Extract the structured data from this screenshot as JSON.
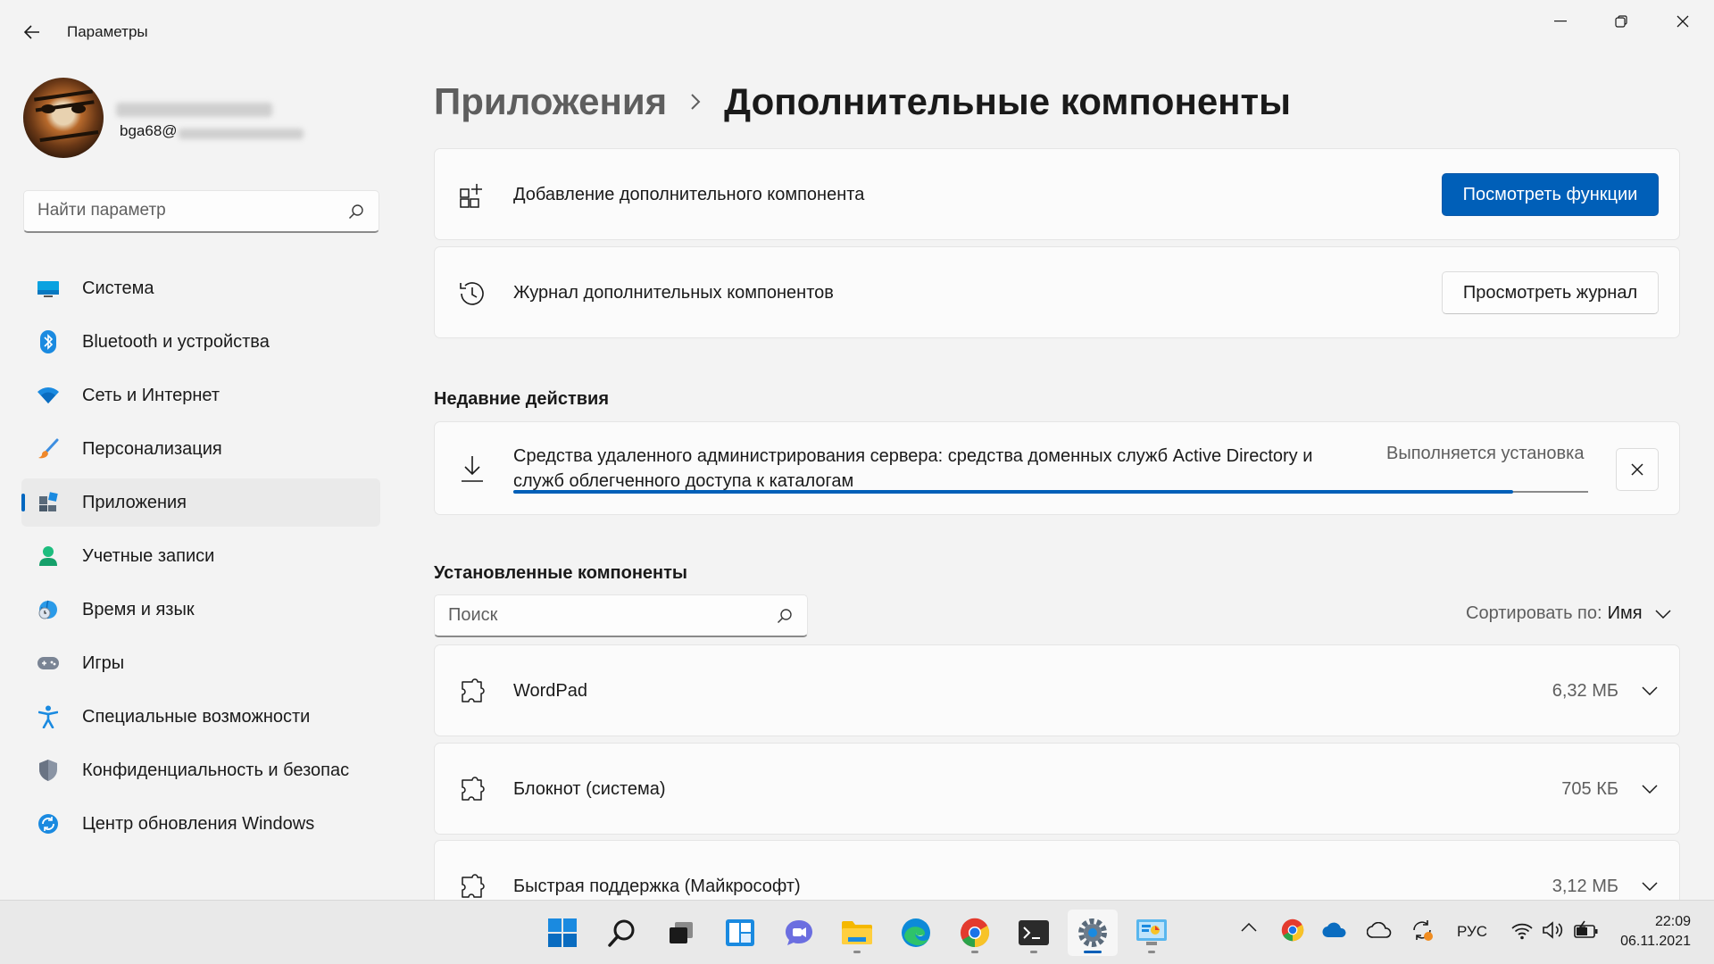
{
  "window": {
    "app_title": "Параметры"
  },
  "user": {
    "email_prefix": "bga68@"
  },
  "sidebar": {
    "search_placeholder": "Найти параметр",
    "items": [
      {
        "label": "Система",
        "icon": "monitor-icon",
        "active": false
      },
      {
        "label": "Bluetooth и устройства",
        "icon": "bluetooth-icon",
        "active": false
      },
      {
        "label": "Сеть и Интернет",
        "icon": "wifi-icon",
        "active": false
      },
      {
        "label": "Персонализация",
        "icon": "brush-icon",
        "active": false
      },
      {
        "label": "Приложения",
        "icon": "apps-icon",
        "active": true
      },
      {
        "label": "Учетные записи",
        "icon": "person-icon",
        "active": false
      },
      {
        "label": "Время и язык",
        "icon": "globe-clock-icon",
        "active": false
      },
      {
        "label": "Игры",
        "icon": "gamepad-icon",
        "active": false
      },
      {
        "label": "Специальные возможности",
        "icon": "accessibility-icon",
        "active": false
      },
      {
        "label": "Конфиденциальность и безопас",
        "icon": "shield-icon",
        "active": false
      },
      {
        "label": "Центр обновления Windows",
        "icon": "update-icon",
        "active": false
      }
    ]
  },
  "breadcrumb": {
    "parent": "Приложения",
    "current": "Дополнительные компоненты"
  },
  "cards": {
    "add": {
      "text": "Добавление дополнительного компонента",
      "button": "Посмотреть функции"
    },
    "history": {
      "text": "Журнал дополнительных компонентов",
      "button": "Просмотреть журнал"
    }
  },
  "recent": {
    "title": "Недавние действия",
    "item": {
      "line1": "Средства удаленного администрирования сервера: средства доменных служб Active Directory и",
      "line2": "служб облегченного доступа к каталогам",
      "status": "Выполняется установка",
      "progress": 0.93
    }
  },
  "installed": {
    "title": "Установленные компоненты",
    "search_placeholder": "Поиск",
    "sort_label": "Сортировать по:",
    "sort_value": "Имя",
    "items": [
      {
        "name": "WordPad",
        "size": "6,32 МБ"
      },
      {
        "name": "Блокнот (система)",
        "size": "705 КБ"
      },
      {
        "name": "Быстрая поддержка (Майкрософт)",
        "size": "3,12 МБ"
      }
    ]
  },
  "taskbar": {
    "language": "РУС",
    "time": "22:09",
    "date": "06.11.2021",
    "accent": "#005fb8"
  }
}
